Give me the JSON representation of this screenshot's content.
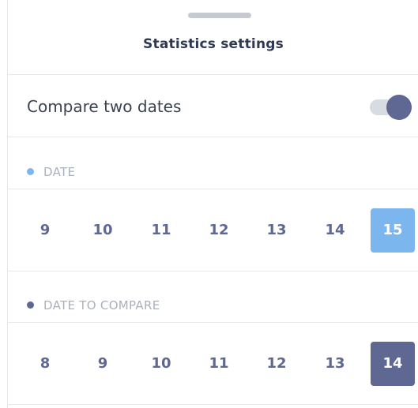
{
  "header": {
    "title": "Statistics settings"
  },
  "compare": {
    "label": "Compare two dates",
    "enabled": true
  },
  "date_section": {
    "label": "DATE",
    "dot_color": "#7cb6ef",
    "days": [
      "9",
      "10",
      "11",
      "12",
      "13",
      "14",
      "15"
    ],
    "selected": "15"
  },
  "compare_section": {
    "label": "DATE TO COMPARE",
    "dot_color": "#5f6892",
    "days": [
      "8",
      "9",
      "10",
      "11",
      "12",
      "13",
      "14"
    ],
    "selected": "14"
  }
}
